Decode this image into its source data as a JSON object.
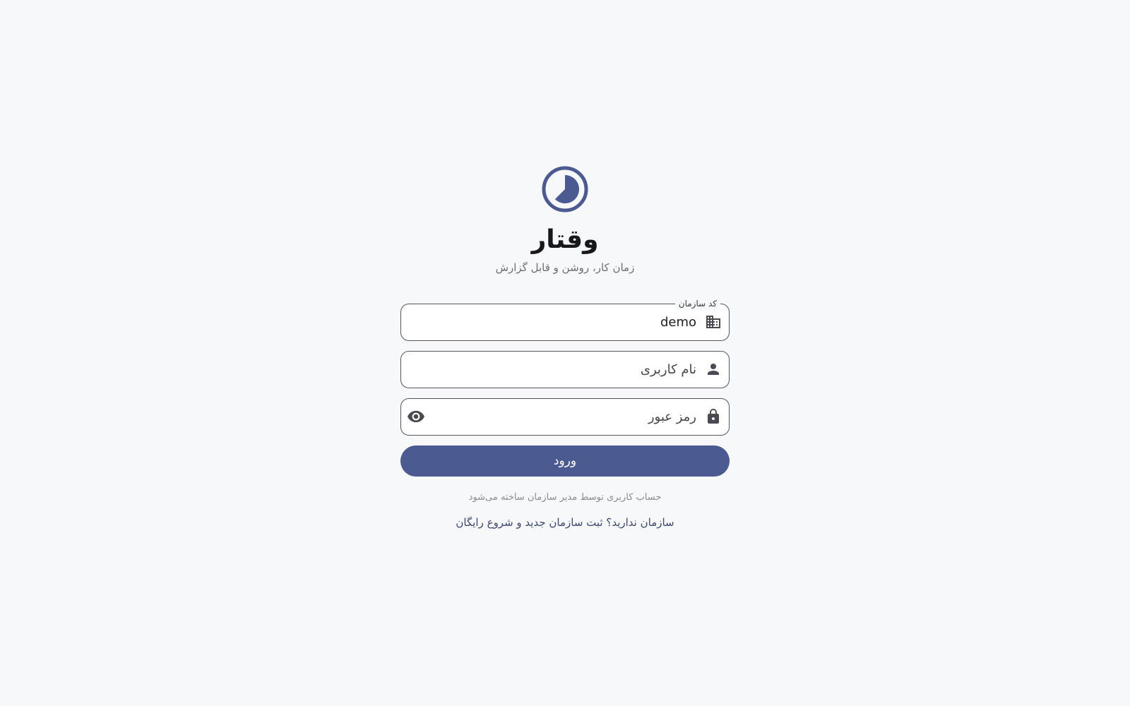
{
  "app": {
    "title": "وقتار",
    "tagline": "زمان کار، روشن و قابل گزارش"
  },
  "colors": {
    "primary": "#4b5a91",
    "background": "#f7f8fa",
    "field_border": "#55555c"
  },
  "form": {
    "org_code": {
      "label": "کد سازمان",
      "value": "demo",
      "icon": "building-icon"
    },
    "username": {
      "placeholder": "نام کاربری",
      "value": "",
      "icon": "person-icon"
    },
    "password": {
      "placeholder": "رمز عبور",
      "value": "",
      "icon": "lock-icon",
      "toggle_icon": "eye-icon"
    },
    "submit_label": "ورود"
  },
  "footer": {
    "note": "حساب کاربری توسط مدیر سازمان ساخته می‌شود",
    "register_link": "سازمان ندارید؟ ثبت سازمان جدید و شروع رایگان"
  }
}
